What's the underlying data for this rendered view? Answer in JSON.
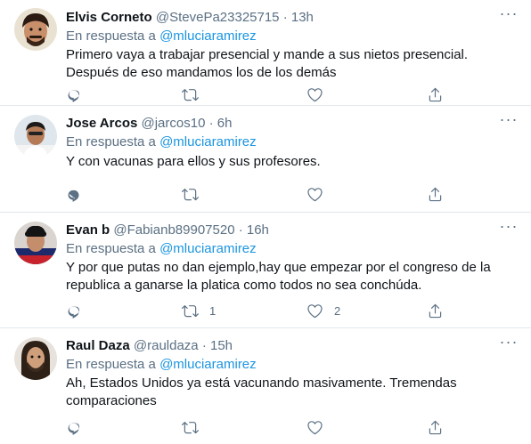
{
  "reply_prefix": "En respuesta a",
  "tweets": [
    {
      "name": "Elvis Corneto",
      "handle": "@StevePa23325715",
      "time": "13h",
      "mention": "@mluciaramirez",
      "text": "Primero vaya a trabajar presencial y mande a sus nietos presencial. Después de eso mandamos los de los demás",
      "retweets": "",
      "likes": ""
    },
    {
      "name": "Jose Arcos",
      "handle": "@jarcos10",
      "time": "6h",
      "mention": "@mluciaramirez",
      "text": "Y con vacunas para ellos y sus profesores.",
      "retweets": "",
      "likes": ""
    },
    {
      "name": "Evan b",
      "handle": "@Fabianb89907520",
      "time": "16h",
      "mention": "@mluciaramirez",
      "text": "Y por que putas no dan ejemplo,hay que empezar por el congreso de la republica a ganarse la platica como todos no sea conchúda.",
      "retweets": "1",
      "likes": "2"
    },
    {
      "name": "Raul Daza",
      "handle": "@rauldaza",
      "time": "15h",
      "mention": "@mluciaramirez",
      "text": "Ah, Estados Unidos ya está vacunando masivamente. Tremendas comparaciones",
      "retweets": "",
      "likes": ""
    }
  ],
  "icons": {
    "more": "more-options-icon",
    "reply": "reply-icon",
    "retweet": "retweet-icon",
    "like": "heart-icon",
    "share": "share-icon"
  },
  "colors": {
    "link": "#1b95e0",
    "secondary_text": "#5b7083",
    "divider": "#e1e8ed"
  }
}
